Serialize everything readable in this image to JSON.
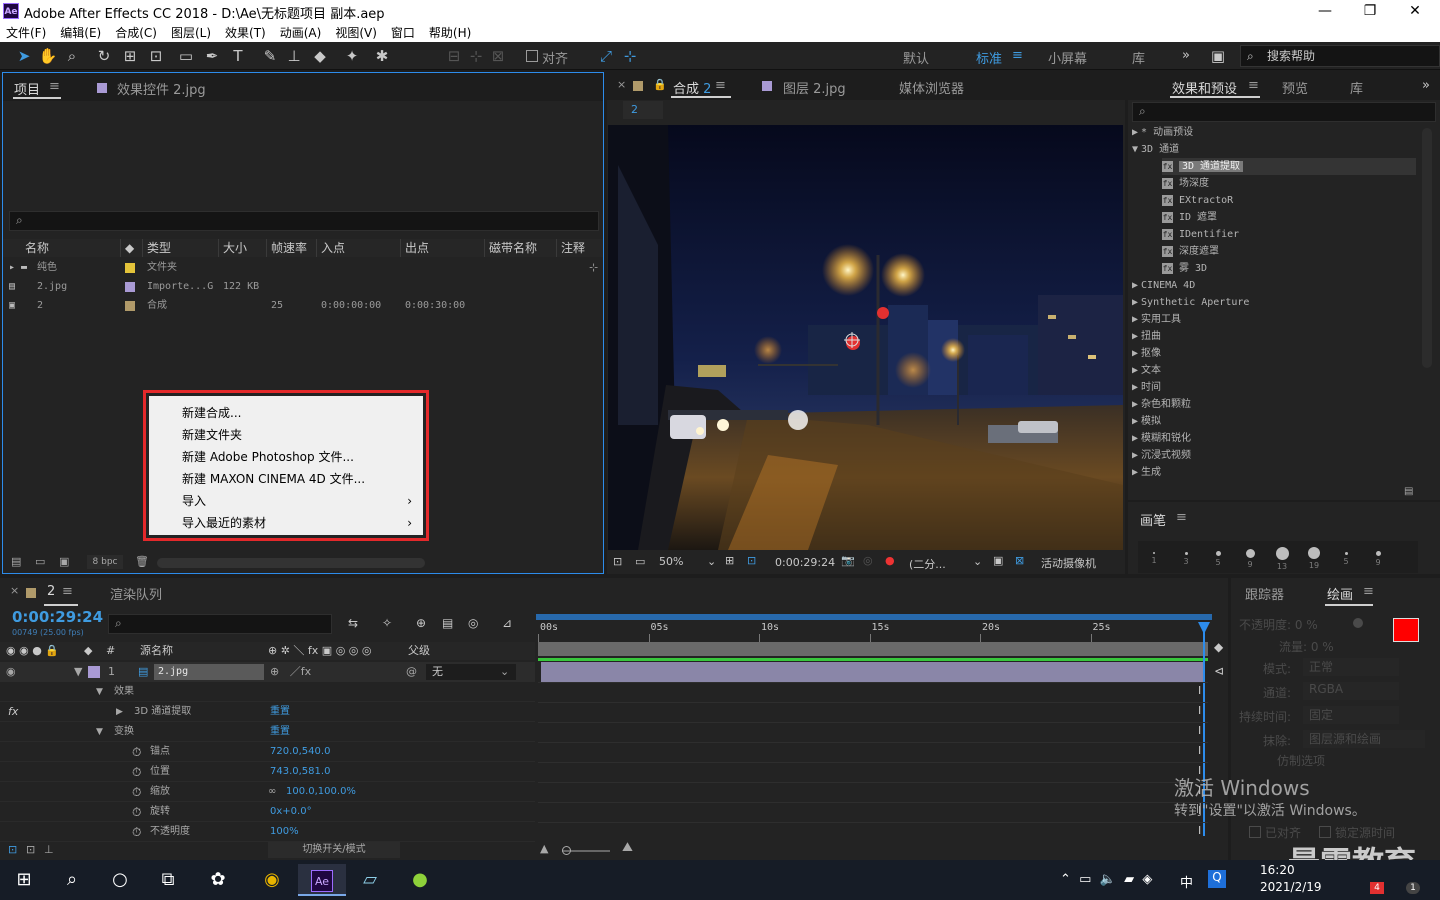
{
  "window": {
    "title": "Adobe After Effects CC 2018 - D:\\Ae\\无标题项目 副本.aep",
    "logo": "Ae",
    "min": "—",
    "max": "❐",
    "close": "✕"
  },
  "menu": [
    "文件(F)",
    "编辑(E)",
    "合成(C)",
    "图层(L)",
    "效果(T)",
    "动画(A)",
    "视图(V)",
    "窗口",
    "帮助(H)"
  ],
  "toolbar": {
    "snap_label": "对齐",
    "workspaces": [
      "默认",
      "标准",
      "小屏幕",
      "库"
    ],
    "active_workspace": "标准",
    "more": "»",
    "help_search": "搜索帮助"
  },
  "project": {
    "tabs": [
      "项目",
      "效果控件 2.jpg"
    ],
    "columns": [
      "名称",
      "类型",
      "大小",
      "帧速率",
      "入点",
      "出点",
      "磁带名称",
      "注释"
    ],
    "rows": [
      {
        "name": "纯色",
        "type": "文件夹",
        "size": "",
        "fps": "",
        "in": "",
        "out": "",
        "label_color": "#e3c33a"
      },
      {
        "name": "2.jpg",
        "type": "Importe...G",
        "size": "122 KB",
        "fps": "",
        "in": "",
        "out": "",
        "label_color": "#a99ad4"
      },
      {
        "name": "2",
        "type": "合成",
        "size": "",
        "fps": "25",
        "in": "0:00:00:00",
        "out": "0:00:30:00",
        "label_color": "#b09a6a"
      }
    ],
    "bpc": "8 bpc"
  },
  "context_menu": {
    "items": [
      {
        "label": "新建合成...",
        "submenu": false
      },
      {
        "label": "新建文件夹",
        "submenu": false
      },
      {
        "label": "新建 Adobe Photoshop 文件...",
        "submenu": false
      },
      {
        "label": "新建 MAXON CINEMA 4D 文件...",
        "submenu": false
      },
      {
        "label": "导入",
        "submenu": true
      },
      {
        "label": "导入最近的素材",
        "submenu": true
      }
    ],
    "submenu_arrow": "›"
  },
  "composition": {
    "tab_label": "合成",
    "tab_comp": "2",
    "other_tabs": [
      "图层 2.jpg",
      "媒体浏览器"
    ],
    "breadcrumb": "2",
    "zoom": "50%",
    "timecode": "0:00:29:24",
    "resolution": "(二分...",
    "camera": "活动摄像机"
  },
  "effects": {
    "tabs": [
      "效果和预设",
      "预览",
      "库"
    ],
    "tree": [
      {
        "label": "* 动画预设",
        "level": 0,
        "open": false
      },
      {
        "label": "3D 通道",
        "level": 0,
        "open": true
      },
      {
        "label": "3D 通道提取",
        "level": 1,
        "selected": true
      },
      {
        "label": "场深度",
        "level": 1
      },
      {
        "label": "EXtractoR",
        "level": 1
      },
      {
        "label": "ID 遮罩",
        "level": 1
      },
      {
        "label": "IDentifier",
        "level": 1
      },
      {
        "label": "深度遮罩",
        "level": 1
      },
      {
        "label": "雾 3D",
        "level": 1
      },
      {
        "label": "CINEMA 4D",
        "level": 0
      },
      {
        "label": "Synthetic Aperture",
        "level": 0
      },
      {
        "label": "实用工具",
        "level": 0
      },
      {
        "label": "扭曲",
        "level": 0
      },
      {
        "label": "抠像",
        "level": 0
      },
      {
        "label": "文本",
        "level": 0
      },
      {
        "label": "时间",
        "level": 0
      },
      {
        "label": "杂色和颗粒",
        "level": 0
      },
      {
        "label": "模拟",
        "level": 0
      },
      {
        "label": "模糊和锐化",
        "level": 0
      },
      {
        "label": "沉浸式视频",
        "level": 0
      },
      {
        "label": "生成",
        "level": 0
      }
    ]
  },
  "brush": {
    "title": "画笔",
    "sizes": [
      "1",
      "3",
      "5",
      "9",
      "13",
      "19",
      "5",
      "9"
    ]
  },
  "timeline": {
    "tabs": [
      "2",
      "渲染队列"
    ],
    "timecode": "0:00:29:24",
    "frame_info": "00749 (25.00 fps)",
    "columns": {
      "num": "#",
      "source": "源名称",
      "parent": "父级"
    },
    "layer": {
      "num": "1",
      "name": "2.jpg",
      "parent": "无"
    },
    "props": [
      {
        "label": "效果",
        "value": "",
        "indent": 1
      },
      {
        "label": "3D 通道提取",
        "value": "重置",
        "indent": 2,
        "fx": true
      },
      {
        "label": "变换",
        "value": "重置",
        "indent": 1
      },
      {
        "label": "锚点",
        "value": "720.0,540.0",
        "indent": 3
      },
      {
        "label": "位置",
        "value": "743.0,581.0",
        "indent": 3
      },
      {
        "label": "缩放",
        "value": "100.0,100.0%",
        "indent": 3
      },
      {
        "label": "旋转",
        "value": "0x+0.0°",
        "indent": 3
      },
      {
        "label": "不透明度",
        "value": "100%",
        "indent": 3
      }
    ],
    "ruler": [
      "00s",
      "05s",
      "10s",
      "15s",
      "20s",
      "25s"
    ],
    "switch_mode": "切换开关/模式"
  },
  "paint": {
    "tabs": [
      "跟踪器",
      "绘画"
    ],
    "opacity": "不透明度: 0 %",
    "flow": "流量: 0 %",
    "mode_label": "模式:",
    "mode_value": "正常",
    "channel_label": "通道:",
    "channel_value": "RGBA",
    "duration_label": "持续时间:",
    "duration_value": "固定",
    "erase_label": "抹除:",
    "erase_value": "图层源和绘画",
    "clone_label": "仿制选项",
    "aligned": "已对齐",
    "lock_source": "锁定源时间",
    "fg_color": "#ff0000",
    "bg_color": "#ffffff"
  },
  "watermark": {
    "line1": "激活 Windows",
    "line2": "转到\"设置\"以激活 Windows。",
    "brand": "最需教育"
  },
  "taskbar": {
    "time": "16:20",
    "date": "2021/2/19",
    "ime": "中",
    "notif_count": "4",
    "chat_count": "1"
  }
}
